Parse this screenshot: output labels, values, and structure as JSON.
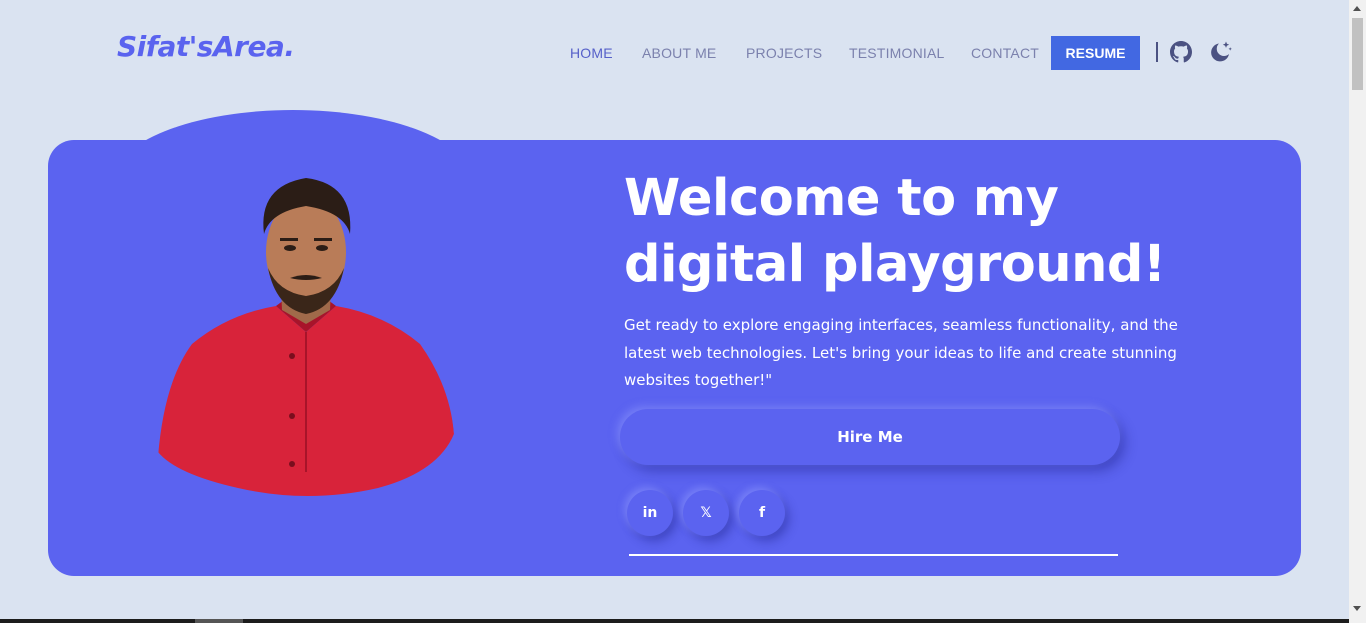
{
  "header": {
    "logo": "Sifat'sArea.",
    "nav": [
      {
        "label": "HOME"
      },
      {
        "label": "ABOUT ME"
      },
      {
        "label": "PROJECTS"
      },
      {
        "label": "TESTIMONIAL"
      },
      {
        "label": "CONTACT"
      }
    ],
    "resume_label": "RESUME",
    "icons": [
      "github-icon",
      "dark-mode-moon-icon"
    ]
  },
  "hero": {
    "title_line1": "Welcome to my",
    "title_line2": "digital playground!",
    "description": "Get ready to explore engaging interfaces, seamless functionality, and the latest web technologies. Let's bring your ideas to life and create stunning websites together!\"",
    "hire_label": "Hire Me",
    "socials": [
      {
        "label": "in",
        "icon": "linkedin-icon"
      },
      {
        "label": "𝕏",
        "icon": "x-twitter-icon"
      },
      {
        "label": "f",
        "icon": "facebook-icon"
      }
    ]
  },
  "colors": {
    "background": "#dae3f1",
    "accent": "#5b63f0",
    "resume_button": "#4268e2",
    "shirt": "#d8233a"
  }
}
